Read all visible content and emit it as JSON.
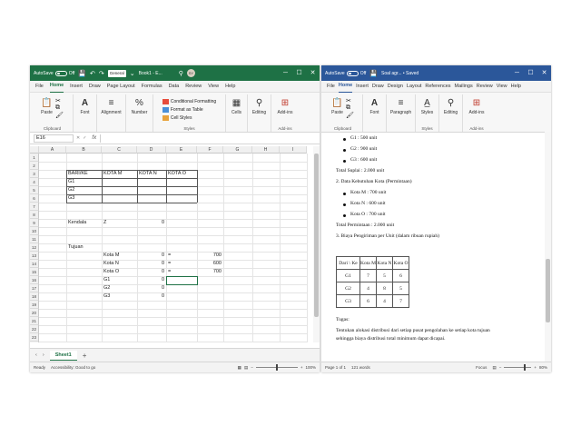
{
  "excel": {
    "autosave_label": "AutoSave",
    "autosave_state": "Off",
    "format_box": "General",
    "file_title": "Book1 - E...",
    "user_initials": "SY",
    "tabs": [
      "File",
      "Home",
      "Insert",
      "Draw",
      "Page Layout",
      "Formulas",
      "Data",
      "Review",
      "View",
      "Help"
    ],
    "ribbon": {
      "paste": "Paste",
      "clipboard": "Clipboard",
      "font": "Font",
      "alignment": "Alignment",
      "number": "Number",
      "cond_format": "Conditional Formatting",
      "format_table": "Format as Table",
      "cell_styles": "Cell Styles",
      "styles_group": "Styles",
      "cells": "Cells",
      "editing": "Editing",
      "addins": "Add-ins",
      "addins_group": "Add-ins"
    },
    "name_box": "E16",
    "fx": "fx",
    "columns": [
      "A",
      "B",
      "C",
      "D",
      "E",
      "F",
      "G",
      "H",
      "I"
    ],
    "rows": [
      "1",
      "2",
      "3",
      "4",
      "5",
      "6",
      "7",
      "8",
      "9",
      "10",
      "11",
      "12",
      "13",
      "14",
      "15",
      "16",
      "17",
      "18",
      "19",
      "20",
      "21",
      "22",
      "23",
      "24"
    ],
    "cells": {
      "b3": "BARI/KE",
      "c3": "KOTA M",
      "d3": "KOTA N",
      "e3": "KOTA O",
      "b4": "G1",
      "b5": "G2",
      "b6": "G3",
      "b9": "Kendala",
      "c9": "Z",
      "d9": "0",
      "b12": "Tujuan",
      "c13": "Kota M",
      "d13": "0",
      "d13b": "=",
      "f13": "700",
      "c14": "Kota N",
      "d14": "0",
      "d14b": "=",
      "f14": "600",
      "c15": "Kota O",
      "d15": "0",
      "d15b": "=",
      "f15": "700",
      "c16": "G1",
      "d16": "0",
      "c17": "G2",
      "d17": "0",
      "c18": "G3",
      "d18": "0"
    },
    "sheet_tab": "Sheet1",
    "add_sheet": "+",
    "status_ready": "Ready",
    "status_access": "Accessibility: Good to go",
    "zoom": "100%"
  },
  "word": {
    "autosave_label": "AutoSave",
    "autosave_state": "Off",
    "file_title": "Soal agr... • Saved",
    "tabs": [
      "File",
      "Home",
      "Insert",
      "Draw",
      "Design",
      "Layout",
      "References",
      "Mailings",
      "Review",
      "View",
      "Help"
    ],
    "ribbon": {
      "paste": "Paste",
      "clipboard": "Clipboard",
      "font": "Font",
      "paragraph": "Paragraph",
      "styles": "Styles",
      "styles_group": "Styles",
      "editing": "Editing",
      "addins": "Add-ins",
      "addins_group": "Add-ins"
    },
    "doc": {
      "l1": "G1 : 500 unit",
      "l2": "G2 : 900 unit",
      "l3": "G3 : 600 unit",
      "l4": "Total Suplai : 2.000 unit",
      "l5": "2. Data Kebutuhan Kota (Permintaan)",
      "l6": "Kota M : 700 unit",
      "l7": "Kota N : 600 unit",
      "l8": "Kota O : 700 unit",
      "l9": "Total Permintaan : 2.000 unit",
      "l10": "3. Biaya Pengiriman per Unit (dalam ribuan rupiah)",
      "l11": "Tugas:",
      "l12": "Tentukan alokasi distribusi dari setiap pusat pengolahan ke setiap kota tujuan",
      "l13": "sehingga biaya distribusi total minimum dapat dicapai."
    },
    "table": {
      "header": [
        "Dari \\ Ke",
        "Kota M",
        "Kota N",
        "Kota O"
      ],
      "rows": [
        [
          "G1",
          "7",
          "5",
          "6"
        ],
        [
          "G2",
          "4",
          "8",
          "5"
        ],
        [
          "G3",
          "6",
          "4",
          "7"
        ]
      ]
    },
    "status_page": "Page 1 of 1",
    "status_words": "121 words",
    "status_focus": "Focus",
    "zoom": "80%"
  }
}
